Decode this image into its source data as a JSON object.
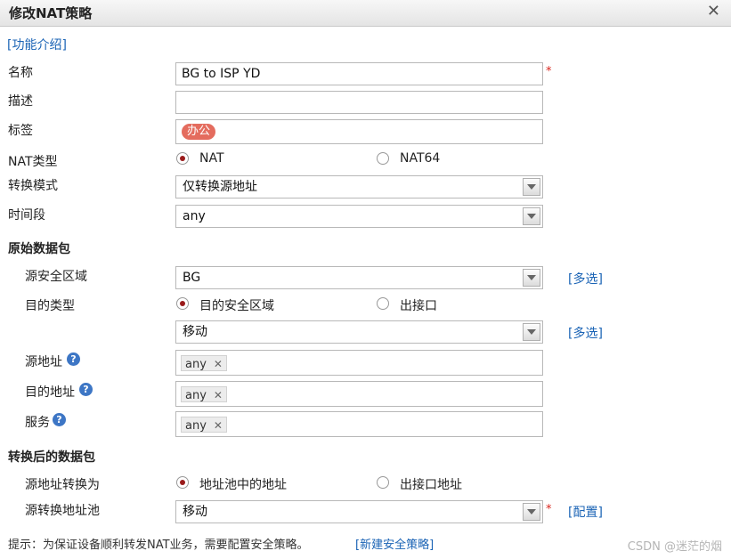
{
  "dialog": {
    "title": "修改NAT策略",
    "close_glyph": "✕"
  },
  "help_link": "[功能介绍]",
  "form": {
    "name": {
      "label": "名称",
      "value": "BG to ISP YD",
      "required": "*"
    },
    "description": {
      "label": "描述",
      "value": ""
    },
    "tags": {
      "label": "标签",
      "items": [
        "办公"
      ]
    },
    "nat_type": {
      "label": "NAT类型",
      "options": [
        "NAT",
        "NAT64"
      ],
      "selected": "NAT"
    },
    "convert_mode": {
      "label": "转换模式",
      "value": "仅转换源地址"
    },
    "time_range": {
      "label": "时间段",
      "value": "any"
    }
  },
  "original_packet": {
    "heading": "原始数据包",
    "src_zone": {
      "label": "源安全区域",
      "value": "BG",
      "multi": "[多选]"
    },
    "dst_type": {
      "label": "目的类型",
      "options": [
        "目的安全区域",
        "出接口"
      ],
      "selected": "目的安全区域"
    },
    "dst_zone": {
      "value": "移动",
      "multi": "[多选]"
    },
    "src_addr": {
      "label": "源地址",
      "chip": "any",
      "chip_x": "✕"
    },
    "dst_addr": {
      "label": "目的地址",
      "chip": "any",
      "chip_x": "✕"
    },
    "service": {
      "label": "服务",
      "chip": "any",
      "chip_x": "✕"
    },
    "help_glyph": "?"
  },
  "translated_packet": {
    "heading": "转换后的数据包",
    "src_translate": {
      "label": "源地址转换为",
      "options": [
        "地址池中的地址",
        "出接口地址"
      ],
      "selected": "地址池中的地址"
    },
    "src_pool": {
      "label": "源转换地址池",
      "value": "移动",
      "required": "*",
      "config": "[配置]"
    }
  },
  "footer": {
    "hint": "提示：为保证设备顺利转发NAT业务，需要配置安全策略。",
    "link": "[新建安全策略]"
  },
  "watermark": "CSDN @迷茫的烟",
  "colors": {
    "accent_link": "#1a63b5",
    "required": "#d9251d",
    "tag": "#e46c5e",
    "radio_on": "#9a1b1b"
  }
}
